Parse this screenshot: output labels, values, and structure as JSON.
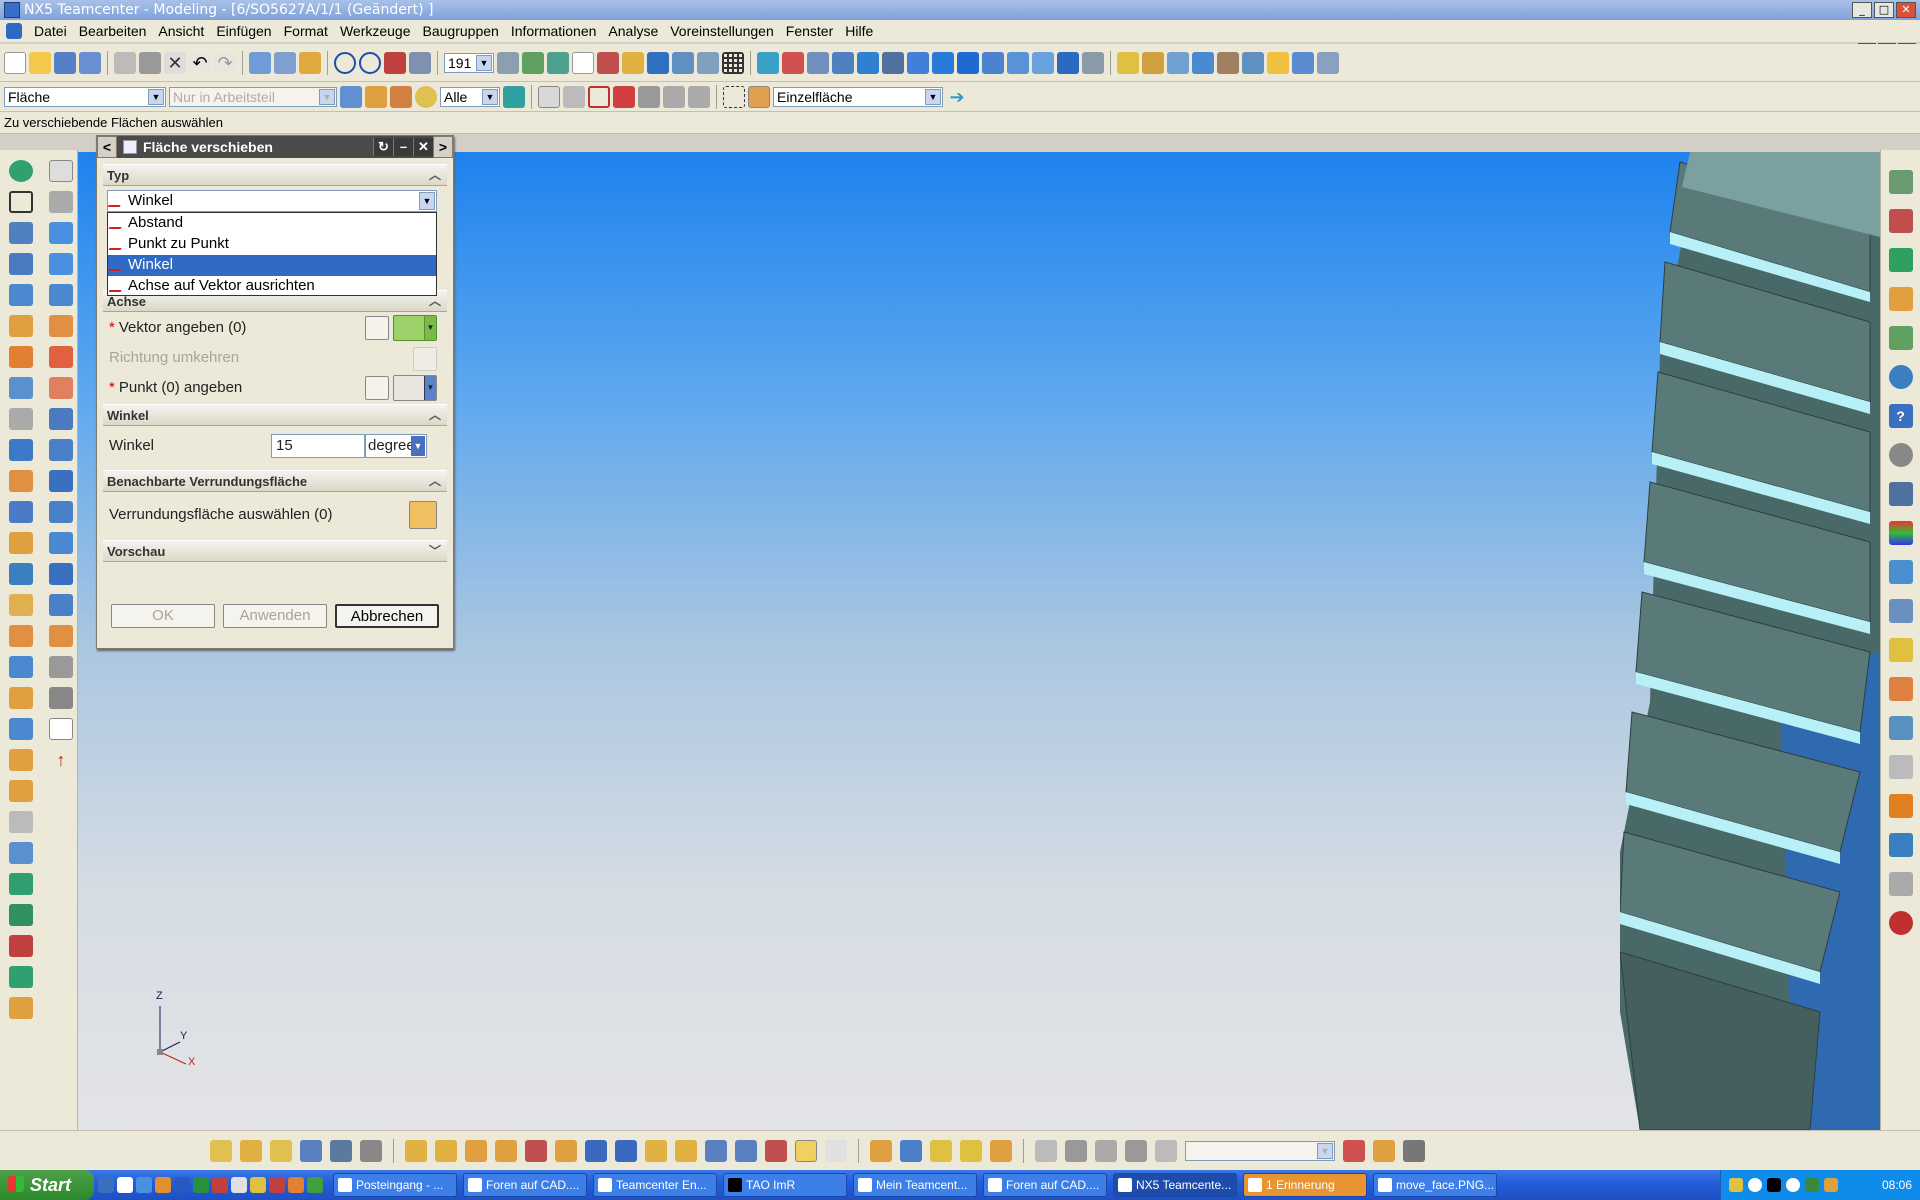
{
  "window": {
    "title": "NX5 Teamcenter - Modeling - [6/SO5627A/1/1 (Geändert) ]"
  },
  "menu": [
    "Datei",
    "Bearbeiten",
    "Ansicht",
    "Einfügen",
    "Format",
    "Werkzeuge",
    "Baugruppen",
    "Informationen",
    "Analyse",
    "Voreinstellungen",
    "Fenster",
    "Hilfe"
  ],
  "toolbar": {
    "zoom_value": "191",
    "filter_type": "Fläche",
    "filter_scope": "Nur in Arbeitsteil",
    "filter_all": "Alle",
    "face_rule": "Einzelfläche"
  },
  "status_prompt": "Zu verschiebende Flächen auswählen",
  "dialog": {
    "title": "Fläche verschieben",
    "nav_prev": "<",
    "nav_next": ">",
    "section_typ": "Typ",
    "type_selected": "Winkel",
    "type_options": [
      "Abstand",
      "Punkt zu Punkt",
      "Winkel",
      "Achse auf Vektor ausrichten"
    ],
    "section_achse": "Achse",
    "vektor_label": "Vektor angeben (0)",
    "richtung_label": "Richtung umkehren",
    "punkt_label": "Punkt (0) angeben",
    "required_mark": "*",
    "section_winkel": "Winkel",
    "winkel_label": "Winkel",
    "winkel_value": "15",
    "winkel_unit": "degrees",
    "section_verrundung": "Benachbarte Verrundungsfläche",
    "verrundung_label": "Verrundungsfläche auswählen (0)",
    "section_vorschau": "Vorschau",
    "ok": "OK",
    "anwenden": "Anwenden",
    "abbrechen": "Abbrechen"
  },
  "triad": {
    "z": "Z",
    "y": "Y",
    "x": "X"
  },
  "taskbar": {
    "start": "Start",
    "tasks": [
      "Posteingang - ...",
      "Foren auf CAD....",
      "Teamcenter En...",
      "TAO ImR",
      "Mein Teamcent...",
      "Foren auf CAD....",
      "NX5 Teamcente...",
      "1 Erinnerung",
      "move_face.PNG..."
    ],
    "clock": "08:06"
  },
  "colors": {
    "accent": "#316ac5",
    "viewport_top": "#1e82ee",
    "part_face": "#5a7a7a",
    "highlight": "#b8f0f8"
  }
}
